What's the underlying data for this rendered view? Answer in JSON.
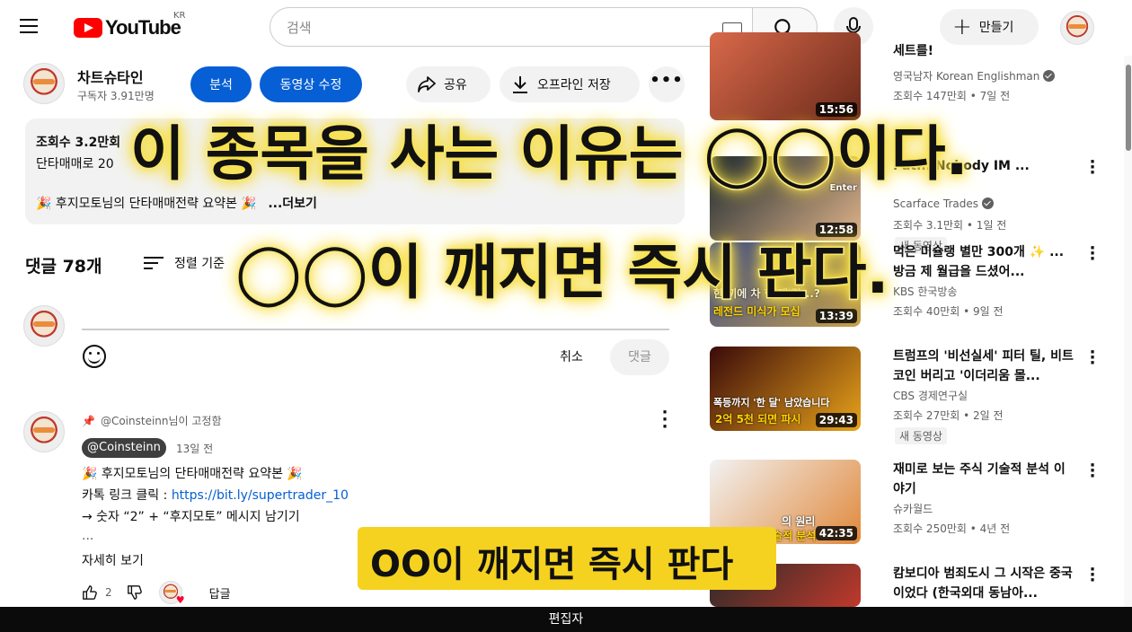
{
  "header": {
    "logo_text": "YouTube",
    "region": "KR",
    "search_placeholder": "검색",
    "create_label": "만들기"
  },
  "channel": {
    "name": "차트슈타인",
    "subscribers": "구독자 3.91만명",
    "analytics_label": "분석",
    "edit_video_label": "동영상 수정",
    "share_label": "공유",
    "offline_label": "오프라인 저장",
    "more_label": "•••"
  },
  "description": {
    "views": "조회수 3.2만회",
    "line1": "단타매매로 20",
    "line2": "🎉 후지모토님의 단타매매전략 요약본 🎉",
    "more_label": "...더보기"
  },
  "comments": {
    "count_label": "댓글 78개",
    "sort_label": "정렬 기준",
    "cancel_label": "취소",
    "submit_label": "댓글",
    "pinned": {
      "pinned_by": "@Coinsteinn님이 고정함",
      "author": "@Coinsteinn",
      "time": "13일 전",
      "line1": "🎉 후지모토님의 단타매매전략 요약본 🎉",
      "line2_prefix": "카톡 링크 클릭 : ",
      "line2_link": "https://bit.ly/supertrader_10",
      "line3": "→ 숫자 “2” + “후지모토” 메시지 남기기",
      "line4": "...",
      "read_more": "자세히 보기",
      "likes": "2",
      "reply_label": "답글"
    }
  },
  "sidebar": [
    {
      "title": "세트를!",
      "channel": "영국남자 Korean Englishman",
      "verified": true,
      "meta": "조회수 147만회 • 7일 전",
      "duration": "15:56",
      "badge": "",
      "thumb_color_a": "#d8694a",
      "thumb_color_b": "#6b2a1a"
    },
    {
      "title": "Pat... Nobody IM ...",
      "channel": "Scarface Trades",
      "verified": true,
      "meta": "조회수 3.1만회 • 1일 전",
      "duration": "12:58",
      "badge": "새 동영상",
      "thumb_color_a": "#1e2a30",
      "thumb_color_b": "#e0b48a"
    },
    {
      "title": "먹은 미슐랭 별만 300개 ✨ ... 방금 제 월급을 드셨어...",
      "channel": "KBS 한국방송",
      "verified": false,
      "meta": "조회수 40만회 • 9일 전",
      "duration": "13:39",
      "badge": "",
      "thumb_color_a": "#3a4a8a",
      "thumb_color_b": "#c9a24a"
    },
    {
      "title": "트럼프의 '비선실세' 피터 틸, 비트코인 버리고 '이더리움 몰...",
      "channel": "CBS 경제연구실",
      "verified": false,
      "meta": "조회수 27만회 • 2일 전",
      "duration": "29:43",
      "badge": "새 동영상",
      "thumb_color_a": "#3a0a0a",
      "thumb_color_b": "#e8a31a"
    },
    {
      "title": "재미로 보는 주식 기술적 분석 이야기",
      "channel": "슈카월드",
      "verified": false,
      "meta": "조회수 250만회 • 4년 전",
      "duration": "42:35",
      "badge": "",
      "thumb_color_a": "#f2f2f2",
      "thumb_color_b": "#e0883a"
    },
    {
      "title": "캄보디아 범죄도시 그 시작은 중국이었다 (한국외대 동남아...",
      "channel": "",
      "verified": false,
      "meta": "",
      "duration": "",
      "badge": "",
      "thumb_color_a": "#2a2a2a",
      "thumb_color_b": "#c0392b"
    }
  ],
  "sidebar_thumb_texts": {
    "item2_a": "Enter",
    "item3_a": "한 끼에 차 한 대 값...?",
    "item3_b": "레전드 미식가 모십",
    "item4_a": "폭등까지 '한 달' 남았습니다",
    "item4_b": "2억 5천 되면 파시",
    "item5_a": "의 원리",
    "item5_b": "술적 분석"
  },
  "overlay": {
    "caption_line1": "이 종목을 사는 이유는 ◯◯이다.",
    "caption_line2": "◯◯이 깨지면 즉시 판다.",
    "subtitle": "OO이 깨지면 즉시 판다"
  },
  "footer": {
    "label": "편집자"
  },
  "colors": {
    "brand_red": "#ff0000",
    "blue_button": "#065fd4",
    "caption_glow": "#f7e14a",
    "subtitle_bg": "#f5d21f"
  }
}
